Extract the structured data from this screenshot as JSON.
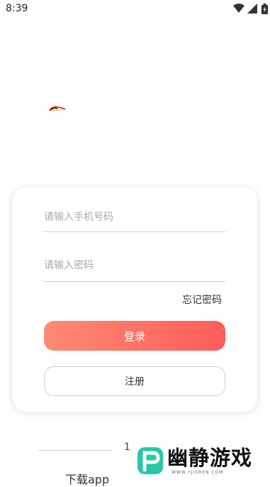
{
  "status_bar": {
    "time": "8:39",
    "icons": [
      "wifi-icon",
      "signal-icon",
      "battery-icon"
    ]
  },
  "login": {
    "phone_placeholder": "请输入手机号码",
    "password_placeholder": "请输入密码",
    "forgot_label": "忘记密码",
    "login_label": "登录",
    "register_label": "注册"
  },
  "footer": {
    "divider_glyph": "1",
    "download_label": "下载app"
  },
  "watermark": {
    "title": "幽静游戏",
    "url": "WWW.YJISREN.COM"
  },
  "colors": {
    "login_gradient_start": "#ff8a73",
    "login_gradient_end": "#ff5c5c",
    "watermark_teal": "#27c7a8"
  }
}
